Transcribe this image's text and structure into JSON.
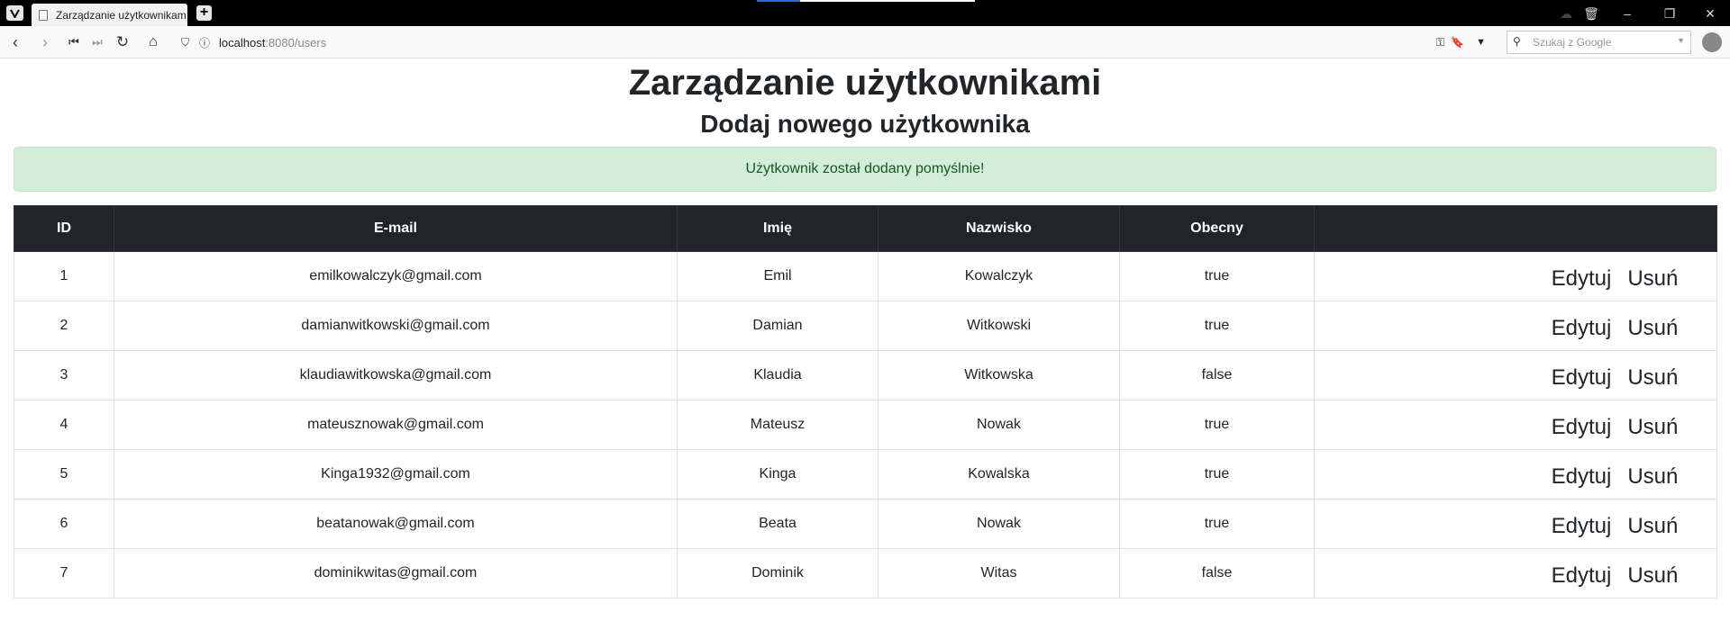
{
  "browser": {
    "tab_title": "Zarządzanie użytkownikam",
    "url_host": "localhost",
    "url_path": ":8080/users",
    "search_placeholder": "Szukaj z Google"
  },
  "page": {
    "title": "Zarządzanie użytkownikami",
    "subtitle": "Dodaj nowego użytkownika",
    "alert": "Użytkownik został dodany pomyślnie!"
  },
  "table": {
    "headers": [
      "ID",
      "E-mail",
      "Imię",
      "Nazwisko",
      "Obecny",
      ""
    ],
    "edit_label": "Edytuj",
    "delete_label": "Usuń",
    "rows": [
      {
        "id": "1",
        "email": "emilkowalczyk@gmail.com",
        "first": "Emil",
        "last": "Kowalczyk",
        "present": "true"
      },
      {
        "id": "2",
        "email": "damianwitkowski@gmail.com",
        "first": "Damian",
        "last": "Witkowski",
        "present": "true"
      },
      {
        "id": "3",
        "email": "klaudiawitkowska@gmail.com",
        "first": "Klaudia",
        "last": "Witkowska",
        "present": "false"
      },
      {
        "id": "4",
        "email": "mateusznowak@gmail.com",
        "first": "Mateusz",
        "last": "Nowak",
        "present": "true"
      },
      {
        "id": "5",
        "email": "Kinga1932@gmail.com",
        "first": "Kinga",
        "last": "Kowalska",
        "present": "true"
      },
      {
        "id": "6",
        "email": "beatanowak@gmail.com",
        "first": "Beata",
        "last": "Nowak",
        "present": "true"
      },
      {
        "id": "7",
        "email": "dominikwitas@gmail.com",
        "first": "Dominik",
        "last": "Witas",
        "present": "false"
      }
    ]
  }
}
